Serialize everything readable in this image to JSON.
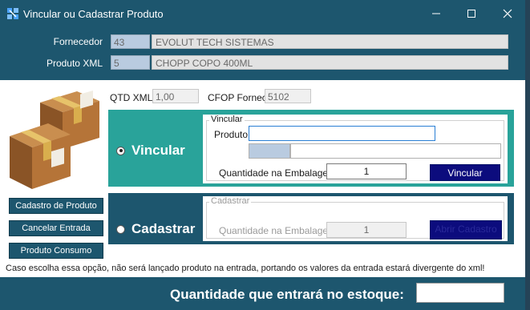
{
  "window": {
    "title": "Vincular ou Cadastrar Produto"
  },
  "titlebar_buttons": [
    {
      "name": "minimize-button",
      "icon": "minimize-icon"
    },
    {
      "name": "maximize-button",
      "icon": "maximize-icon"
    },
    {
      "name": "close-button",
      "icon": "close-icon"
    }
  ],
  "header": {
    "fornecedor_label": "Fornecedor",
    "fornecedor_id": "43",
    "fornecedor_name": "EVOLUT TECH SISTEMAS",
    "produto_xml_label": "Produto XML",
    "produto_id": "5",
    "produto_name": "CHOPP COPO 400ML"
  },
  "info": {
    "qtd_xml_label": "QTD XML",
    "qtd_xml_value": "1,00",
    "cfop_label": "CFOP Fornec",
    "cfop_value": "5102"
  },
  "side_buttons": {
    "cadastro": "Cadastro de Produto",
    "cancelar": "Cancelar Entrada",
    "consumo": "Produto Consumo"
  },
  "vincular": {
    "option_label": "Vincular",
    "group_legend": "Vincular",
    "produto_label": "Produto",
    "produto_value": "",
    "qtd_embalagem_label": "Quantidade na Embalagem",
    "qtd_embalagem_value": "1",
    "button_label": "Vincular",
    "selected": true
  },
  "cadastrar": {
    "option_label": "Cadastrar",
    "group_legend": "Cadastrar",
    "qtd_embalagem_label": "Quantidade na Embalagem",
    "qtd_embalagem_value": "1",
    "button_label": "Abrir Cadastro",
    "selected": false
  },
  "note": "Caso escolha essa opção, não será lançado produto na entrada, portando os valores da entrada estará divergente do xml!",
  "footer": {
    "label": "Quantidade que entrará no estoque:",
    "value": ""
  },
  "colors": {
    "window": "#1d566e",
    "vincular_panel": "#29a39a",
    "primary_button": "#0c0c7d"
  }
}
